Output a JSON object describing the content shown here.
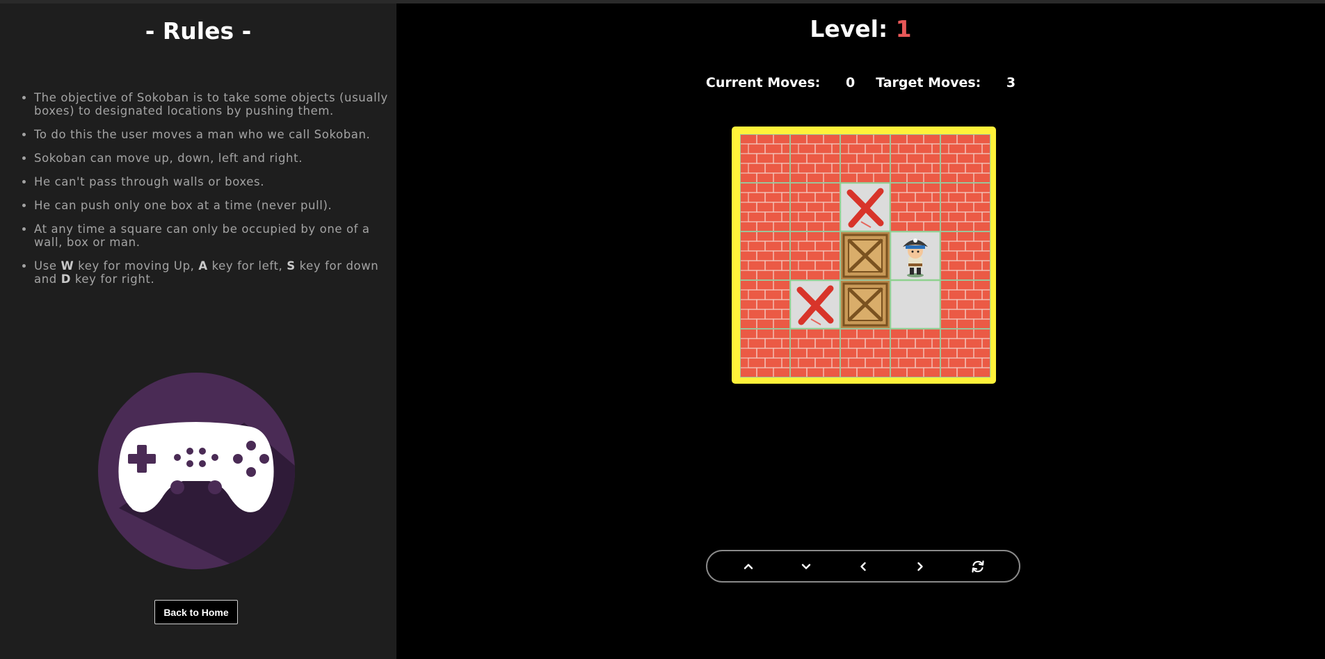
{
  "rules": {
    "title": "- Rules -",
    "items": [
      "The objective of Sokoban is to take some objects (usually boxes) to designated locations by pushing them.",
      "To do this the user moves a man who we call Sokoban.",
      "Sokoban can move up, down, left and right.",
      "He can't pass through walls or boxes.",
      "He can push only one box at a time (never pull).",
      "At any time a square can only be occupied by one of a wall, box or man."
    ],
    "keys_rule": {
      "p1": "Use ",
      "k1": "W",
      "p2": " key for moving Up, ",
      "k2": "A",
      "p3": " key for left, ",
      "k3": "S",
      "p4": " key for down and ",
      "k4": "D",
      "p5": " key for right."
    },
    "back_button": "Back to Home"
  },
  "game": {
    "level_label": "Level:",
    "level": "1",
    "current_moves_label": "Current Moves:",
    "current_moves": "0",
    "target_moves_label": "Target Moves:",
    "target_moves": "3",
    "grid": [
      [
        "wall",
        "wall",
        "wall",
        "wall",
        "wall"
      ],
      [
        "wall",
        "wall",
        "target",
        "wall",
        "wall"
      ],
      [
        "wall",
        "wall",
        "box",
        "player",
        "wall"
      ],
      [
        "wall",
        "target",
        "box",
        "floor",
        "wall"
      ],
      [
        "wall",
        "wall",
        "wall",
        "wall",
        "wall"
      ]
    ]
  },
  "controls": [
    {
      "name": "up-button",
      "icon": "chevron-up-icon"
    },
    {
      "name": "down-button",
      "icon": "chevron-down-icon"
    },
    {
      "name": "left-button",
      "icon": "chevron-left-icon"
    },
    {
      "name": "right-button",
      "icon": "chevron-right-icon"
    },
    {
      "name": "restart-button",
      "icon": "refresh-icon"
    }
  ],
  "colors": {
    "panel": "#1e1e1e",
    "accent_level": "#e85858",
    "board_frame": "#fff23a",
    "brick": "#eb5a45",
    "controller_bg": "#4a2b55"
  }
}
